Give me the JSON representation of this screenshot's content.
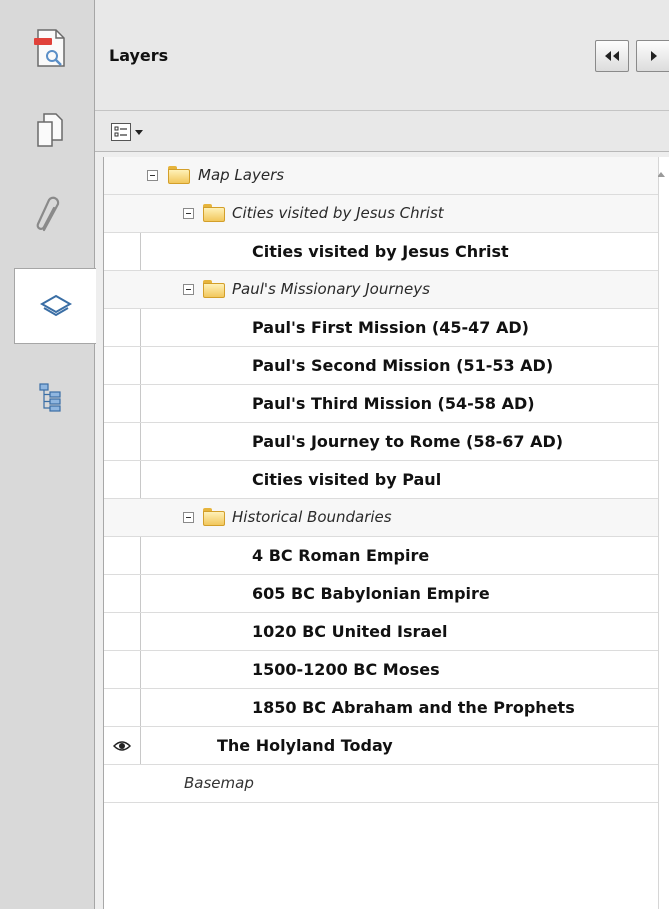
{
  "panel": {
    "title": "Layers"
  },
  "rail": {
    "icons": [
      "page-thumbnail-icon",
      "pages-icon",
      "attachments-icon",
      "layers-icon",
      "bookmarks-icon"
    ]
  },
  "tree": {
    "root": {
      "label": "Map Layers"
    },
    "group_jesus": {
      "label": "Cities visited by Jesus Christ"
    },
    "layer_jesus": {
      "label": "Cities visited by Jesus Christ"
    },
    "group_paul": {
      "label": "Paul's Missionary Journeys"
    },
    "paul_layers": [
      {
        "label": "Paul's First Mission (45-47 AD)"
      },
      {
        "label": "Paul's Second Mission (51-53 AD)"
      },
      {
        "label": "Paul's Third Mission (54-58 AD)"
      },
      {
        "label": "Paul's Journey to Rome (58-67 AD)"
      },
      {
        "label": "Cities visited by Paul"
      }
    ],
    "group_boundaries": {
      "label": "Historical Boundaries"
    },
    "boundary_layers": [
      {
        "label": "4 BC Roman Empire"
      },
      {
        "label": "605 BC Babylonian Empire"
      },
      {
        "label": "1020 BC United Israel"
      },
      {
        "label": "1500-1200 BC Moses"
      },
      {
        "label": "1850 BC Abraham and the Prophets"
      }
    ],
    "holyland": {
      "label": "The Holyland Today",
      "visible": true
    },
    "basemap": {
      "label": "Basemap"
    }
  },
  "colors": {
    "folder": "#f2c75c",
    "rail_bg": "#d9d9d9",
    "panel_bg": "#e8e8e8"
  }
}
